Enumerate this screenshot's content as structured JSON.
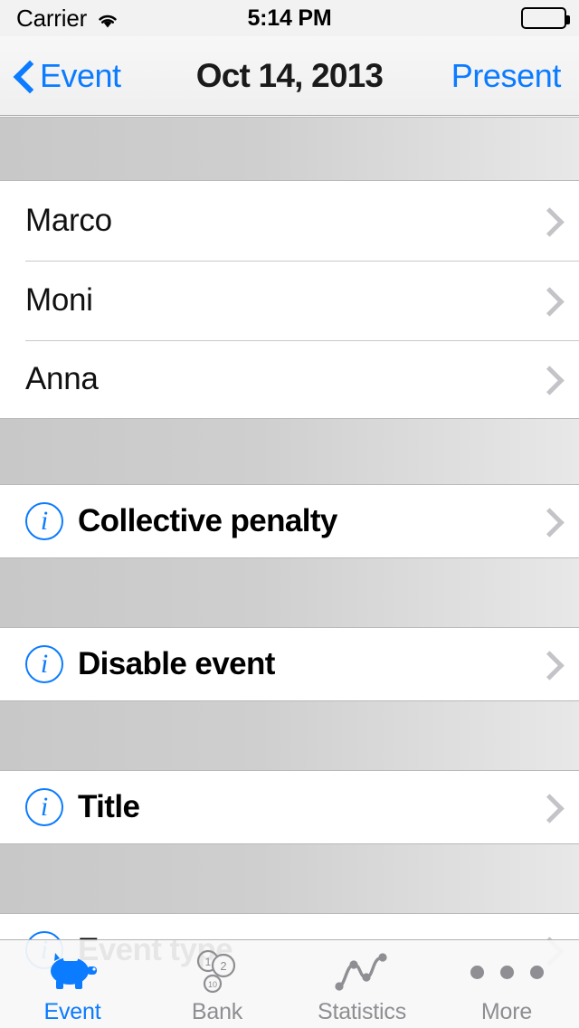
{
  "status_bar": {
    "carrier": "Carrier",
    "wifi_icon": "wifi-icon",
    "time": "5:14 PM",
    "battery_icon": "battery-full-icon"
  },
  "nav_bar": {
    "back_label": "Event",
    "back_icon": "chevron-left-icon",
    "title": "Oct 14, 2013",
    "right_action": "Present"
  },
  "sections": [
    {
      "rows": [
        {
          "label": "Marco",
          "style": "plain",
          "accessory": "chevron-right-icon"
        },
        {
          "label": "Moni",
          "style": "plain",
          "accessory": "chevron-right-icon"
        },
        {
          "label": "Anna",
          "style": "plain",
          "accessory": "chevron-right-icon"
        }
      ]
    },
    {
      "rows": [
        {
          "label": "Collective penalty",
          "style": "bold",
          "icon": "info-circle-icon",
          "accessory": "chevron-right-icon"
        }
      ]
    },
    {
      "rows": [
        {
          "label": "Disable event",
          "style": "bold",
          "icon": "info-circle-icon",
          "accessory": "chevron-right-icon"
        }
      ]
    },
    {
      "rows": [
        {
          "label": "Title",
          "style": "bold",
          "icon": "info-circle-icon",
          "accessory": "chevron-right-icon"
        }
      ]
    },
    {
      "rows": [
        {
          "label": "Event type",
          "style": "bold",
          "icon": "info-circle-icon",
          "accessory": "chevron-right-icon"
        }
      ]
    }
  ],
  "rows_flat": {
    "r0": "Marco",
    "r1": "Moni",
    "r2": "Anna",
    "r3": "Collective penalty",
    "r4": "Disable event",
    "r5": "Title",
    "r6": "Event type",
    "info_glyph": "i"
  },
  "tab_bar": {
    "items": [
      {
        "label": "Event",
        "icon": "piggy-bank-icon",
        "active": true
      },
      {
        "label": "Bank",
        "icon": "coins-icon",
        "active": false
      },
      {
        "label": "Statistics",
        "icon": "line-chart-icon",
        "active": false
      },
      {
        "label": "More",
        "icon": "ellipsis-icon",
        "active": false
      }
    ],
    "coin_values": [
      "1",
      "2",
      "10"
    ]
  },
  "colors": {
    "accent": "#0b7bff",
    "inactive": "#8e8e93",
    "separator": "#c8c7cc",
    "chevron": "#c4c4c8"
  }
}
